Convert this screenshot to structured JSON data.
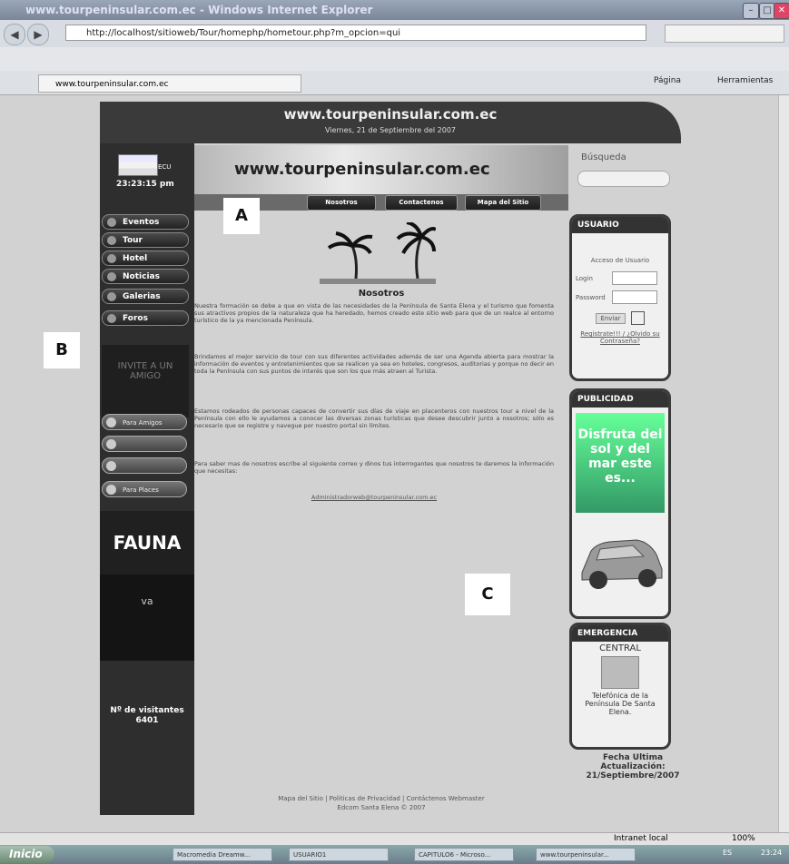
{
  "window": {
    "title": "www.tourpeninsular.com.ec - Windows Internet Explorer"
  },
  "browser": {
    "address": "http://localhost/sitioweb/Tour/homephp/hometour.php?m_opcion=qui",
    "tab_label": "www.tourpeninsular.com.ec",
    "toolbar": {
      "page": "Página",
      "tools": "Herramientas"
    },
    "status_zone": "Intranet local",
    "zoom": "100%"
  },
  "site": {
    "banner_title": "www.tourpeninsular.com.ec",
    "banner_date": "Viernes, 21 de Septiembre del 2007",
    "header_title": "www.tourpeninsular.com.ec",
    "flag_label": "ECU",
    "clock": "23:23:15 pm",
    "nav_links": [
      "Nosotros",
      "Contactenos",
      "Mapa del Sitio"
    ],
    "left_menu": [
      "Eventos",
      "Tour",
      "Hotel",
      "Noticias",
      "Galerias",
      "Foros"
    ],
    "friend_box": "INVITE A UN AMIGO",
    "pills": [
      "Para Amigos",
      "",
      "",
      "Para Places"
    ],
    "fauna": "FAUNA",
    "va": "va",
    "visitors_label": "Nº de visitantes",
    "visitors_count": "6401",
    "callouts": {
      "a": "A",
      "b": "B",
      "c": "C"
    },
    "nosotros_title": "Nosotros",
    "paragraphs": [
      "Nuestra formación se debe a que en vista de las necesidades de la Península de Santa Elena y el turismo que fomenta sus atractivos propios de la naturaleza que ha heredado, hemos creado este sitio web para que de un realce al entorno turístico de la ya mencionada Península.",
      "Brindamos el mejor servicio de tour con sus diferentes actividades además de ser una Agenda abierta para mostrar la información de eventos y entretenimientos que se realicen ya sea en hoteles, congresos, auditorias y porque no decir en toda la Península con sus puntos de interés que son los que más atraen al Turista.",
      "Estamos rodeados de personas capaces de convertir sus días de viaje en placenteros con nuestros tour a nivel de la Península con ello le ayudamos a conocer las diversas zonas turísticas que desee descubrir junto a nosotros; sólo es necesario que se registre y navegue por nuestro portal sin límites.",
      "Para saber mas de nosotros escribe al siguiente correo y dinos tus interrogantes que nosotros te daremos la información que necesitas:"
    ],
    "email": "Administradorweb@tourpeninsular.com.ec",
    "search_label": "Búsqueda",
    "user_panel": {
      "title": "USUARIO",
      "access": "Acceso de Usuario",
      "login": "Login",
      "password": "Password",
      "send": "Enviar",
      "register": "Registrate!!!",
      "forgot": "¿Olvido su Contraseña?"
    },
    "ad_panel": {
      "title": "PUBLICIDAD",
      "ad_text": "Disfruta del sol y del mar este es..."
    },
    "emergency_panel": {
      "title": "EMERGENCIA",
      "central": "CENTRAL",
      "text": "Telefónica de la Península De Santa Elena."
    },
    "update_label": "Fecha Ultima Actualización:",
    "update_date": "21/Septiembre/2007",
    "footer_links": "Mapa del Sitio | Politicas de Privacidad | Contáctenos Webmaster",
    "footer_copy": "Edcom Santa Elena © 2007"
  },
  "taskbar": {
    "start": "Inicio",
    "tasks": [
      "Macromedia Dreamw...",
      "USUARIO1",
      "CAPITULO6 - Microso...",
      "www.tourpeninsular..."
    ],
    "lang": "ES",
    "time": "23:24"
  }
}
